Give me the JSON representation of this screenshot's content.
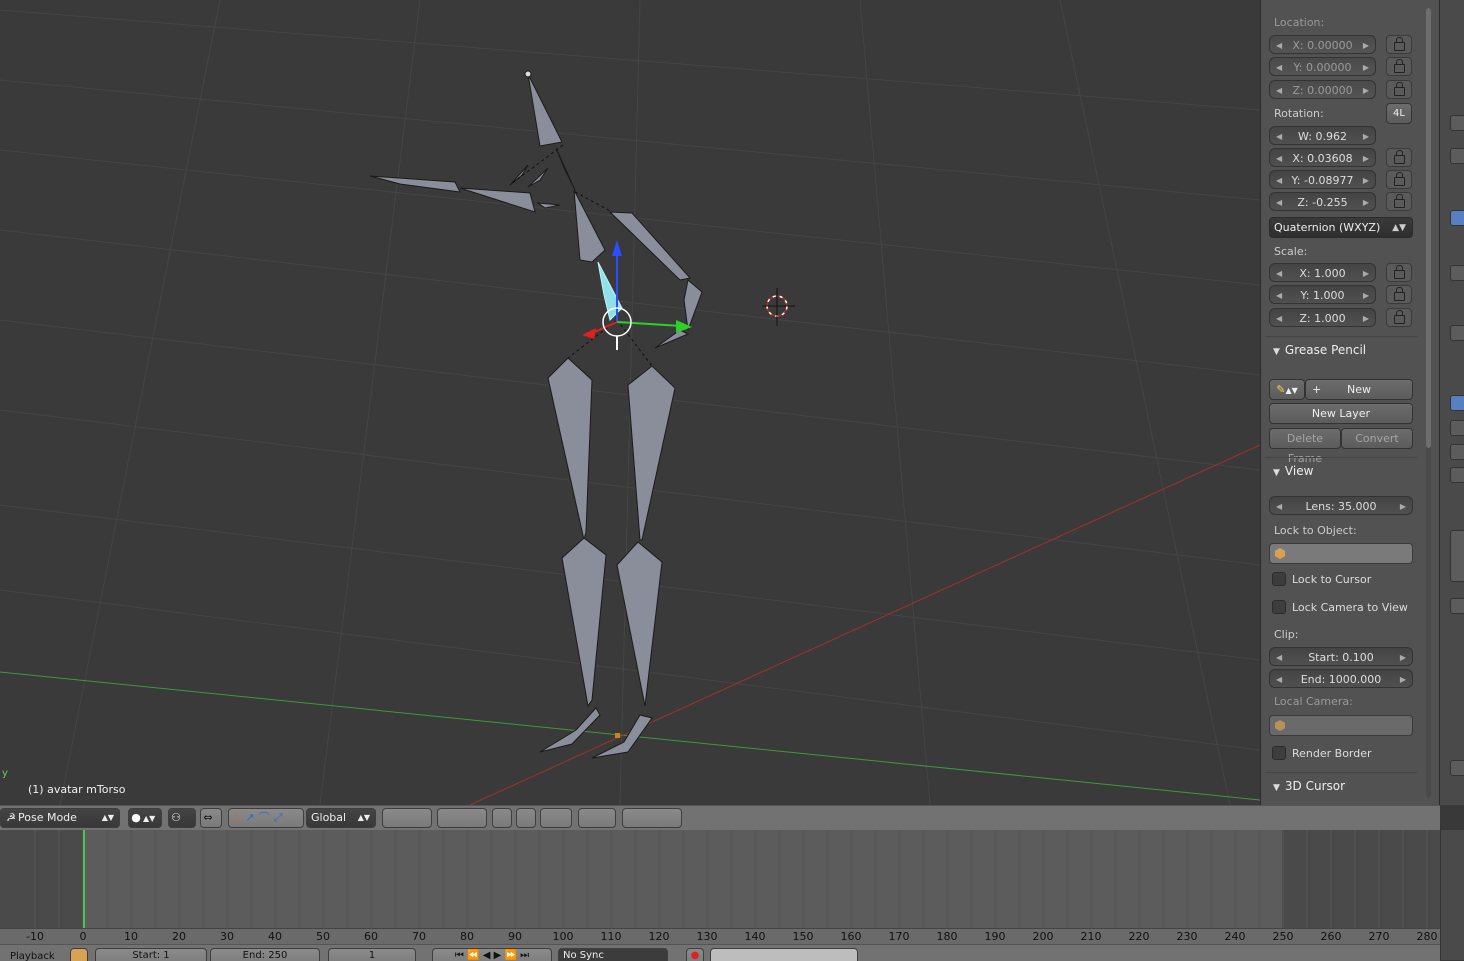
{
  "viewport": {
    "object_label": "(1) avatar mTorso",
    "axis_label": "y"
  },
  "panel": {
    "location": {
      "label": "Location:",
      "x": "X: 0.00000",
      "y": "Y: 0.00000",
      "z": "Z: 0.00000"
    },
    "rotation": {
      "label": "Rotation:",
      "mode_button": "4L",
      "w": "W: 0.962",
      "x": "X: 0.03608",
      "y": "Y: -0.08977",
      "z": "Z: -0.255",
      "mode": "Quaternion (WXYZ)"
    },
    "scale": {
      "label": "Scale:",
      "x": "X: 1.000",
      "y": "Y: 1.000",
      "z": "Z: 1.000"
    },
    "grease_pencil": {
      "title": "Grease Pencil",
      "new_label": "New",
      "new_layer_label": "New Layer",
      "delete_frame_label": "Delete Frame",
      "convert_label": "Convert"
    },
    "view": {
      "title": "View",
      "lens": "Lens: 35.000",
      "lock_to_object_label": "Lock to Object:",
      "lock_to_cursor_label": "Lock to Cursor",
      "lock_to_cursor_checked": false,
      "lock_camera_label": "Lock Camera to View",
      "lock_camera_checked": false,
      "clip_label": "Clip:",
      "clip_start": "Start: 0.100",
      "clip_end": "End: 1000.000",
      "local_camera_label": "Local Camera:",
      "render_border_label": "Render Border",
      "render_border_checked": false
    },
    "cursor_section": {
      "title": "3D Cursor"
    }
  },
  "header": {
    "mode": "Pose Mode",
    "orientation": "Global"
  },
  "timeline": {
    "ticks": [
      "-10",
      "0",
      "10",
      "20",
      "30",
      "40",
      "50",
      "60",
      "70",
      "80",
      "90",
      "100",
      "110",
      "120",
      "130",
      "140",
      "150",
      "160",
      "170",
      "180",
      "190",
      "200",
      "210",
      "220",
      "230",
      "240",
      "250",
      "260",
      "270",
      "280"
    ],
    "playback_label": "Playback",
    "start": "Start: 1",
    "end": "End: 250",
    "current_frame": "1",
    "sync": "No Sync"
  },
  "colors": {
    "viewport_bg": "#3a3a3a",
    "panel_bg": "#525252",
    "x_axis": "#a03030",
    "y_axis": "#3a9a3a",
    "selected_bone": "#8fe0e8",
    "frame_marker": "#4fc24f"
  }
}
